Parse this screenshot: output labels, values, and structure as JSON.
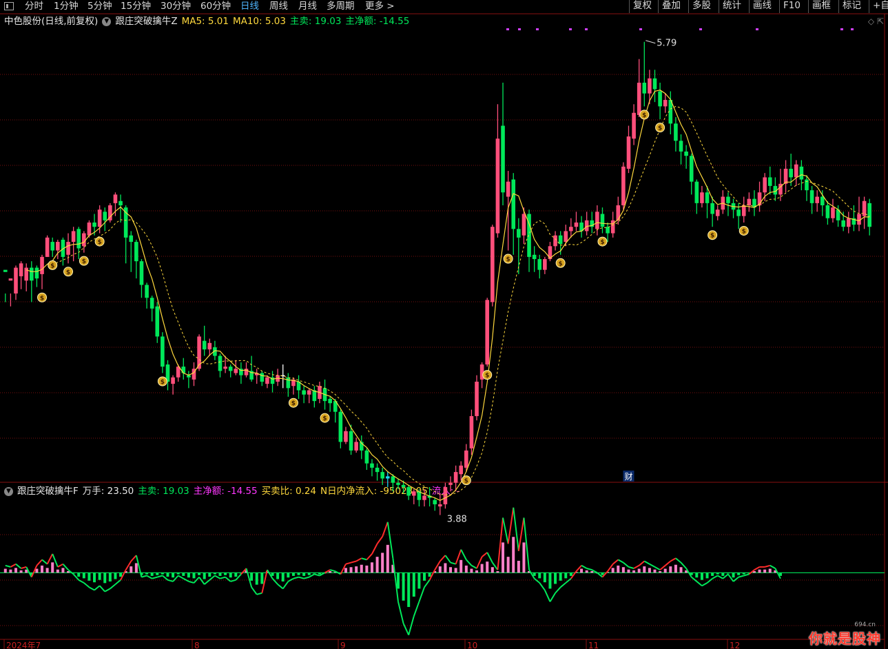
{
  "toolbar": {
    "periods": [
      "分时",
      "1分钟",
      "5分钟",
      "15分钟",
      "30分钟",
      "60分钟",
      "日线",
      "周线",
      "月线",
      "多周期",
      "更多 >"
    ],
    "active_period": "日线",
    "right_buttons": [
      "复权",
      "叠加",
      "多股",
      "统计",
      "画线",
      "F10",
      "画框",
      "标记",
      "+自"
    ]
  },
  "main_header": {
    "stock_title": "中色股份(日线,前复权)",
    "indicator_name": "跟庄突破擒牛Z",
    "ma5": "MA5: 5.01",
    "ma10": "MA10: 5.03",
    "main_sell": "主卖: 19.03",
    "main_net": "主净额: -14.55"
  },
  "sub_header": {
    "indicator_name": "跟庄突破擒牛F",
    "wanshou": "万手: 23.50",
    "main_sell": "主卖: 19.03",
    "main_net": "主净额: -14.55",
    "buy_sell_ratio": "买卖比: 0.24",
    "n_day_inflow": "N日内净流入: -95023.05",
    "inflow": "流入: -"
  },
  "annotations": {
    "high_label": "5.79",
    "low_label": "3.88",
    "finance_marker": "财"
  },
  "watermark": {
    "text": "你就是股神",
    "site": "694.cn"
  },
  "colors": {
    "up": "#ff4f7b",
    "down": "#00e85a",
    "flat": "#ffffff",
    "doji_cyan": "#18d6f0",
    "ma5": "#ffd93d",
    "ma10": "#ffd93d",
    "grid": "#7a1010",
    "flow_pos": "#ff2b2b",
    "flow_neg": "#00e85a",
    "bar_pos": "#ff80c8"
  },
  "chart_data": {
    "type": "candlestick",
    "x_labels": [
      "2024年7",
      "8",
      "9",
      "10",
      "11",
      "12"
    ],
    "y_range": [
      3.8,
      5.85
    ],
    "candles": [
      [
        4.73,
        4.72,
        4.62,
        4.58
      ],
      [
        4.68,
        4.69,
        4.62,
        4.56
      ],
      [
        4.62,
        4.74,
        4.75,
        4.59
      ],
      [
        4.7,
        4.76,
        4.77,
        4.64
      ],
      [
        4.68,
        4.74,
        4.76,
        4.63
      ],
      [
        4.74,
        4.68,
        4.77,
        4.58
      ],
      [
        4.74,
        4.69,
        4.75,
        4.65
      ],
      [
        4.71,
        4.79,
        4.8,
        4.64
      ],
      [
        4.79,
        4.88,
        4.89,
        4.79
      ],
      [
        4.86,
        4.82,
        4.88,
        4.79
      ],
      [
        4.82,
        4.86,
        4.87,
        4.78
      ],
      [
        4.87,
        4.79,
        4.88,
        4.75
      ],
      [
        4.8,
        4.86,
        4.9,
        4.76
      ],
      [
        4.86,
        4.91,
        4.93,
        4.77
      ],
      [
        4.92,
        4.83,
        4.93,
        4.78
      ],
      [
        4.84,
        4.9,
        4.91,
        4.81
      ],
      [
        4.89,
        4.95,
        4.96,
        4.88
      ],
      [
        4.95,
        4.93,
        4.99,
        4.89
      ],
      [
        4.93,
        5.01,
        5.03,
        4.9
      ],
      [
        5.0,
        4.96,
        5.02,
        4.91
      ],
      [
        4.96,
        5.03,
        5.04,
        4.95
      ],
      [
        5.04,
        5.08,
        5.09,
        4.98
      ],
      [
        5.05,
        5.03,
        5.08,
        4.95
      ],
      [
        5.02,
        4.88,
        5.03,
        4.76
      ],
      [
        4.89,
        4.86,
        4.91,
        4.72
      ],
      [
        4.86,
        4.77,
        4.87,
        4.69
      ],
      [
        4.77,
        4.66,
        4.78,
        4.6
      ],
      [
        4.66,
        4.6,
        4.67,
        4.55
      ],
      [
        4.6,
        4.55,
        4.61,
        4.49
      ],
      [
        4.56,
        4.42,
        4.58,
        4.39
      ],
      [
        4.42,
        4.28,
        4.44,
        4.25
      ],
      [
        4.29,
        4.21,
        4.31,
        4.17
      ],
      [
        4.2,
        4.23,
        4.24,
        4.15
      ],
      [
        4.23,
        4.28,
        4.29,
        4.21
      ],
      [
        4.28,
        4.25,
        4.32,
        4.22
      ],
      [
        4.24,
        4.23,
        4.26,
        4.18
      ],
      [
        4.22,
        4.27,
        4.3,
        4.19
      ],
      [
        4.27,
        4.42,
        4.43,
        4.26
      ],
      [
        4.4,
        4.36,
        4.47,
        4.33
      ],
      [
        4.36,
        4.39,
        4.41,
        4.33
      ],
      [
        4.37,
        4.33,
        4.4,
        4.31
      ],
      [
        4.33,
        4.26,
        4.34,
        4.23
      ],
      [
        4.27,
        4.28,
        4.33,
        4.25
      ],
      [
        4.28,
        4.26,
        4.29,
        4.23
      ],
      [
        4.25,
        4.27,
        4.31,
        4.24
      ],
      [
        4.27,
        4.24,
        4.3,
        4.2
      ],
      [
        4.24,
        4.27,
        4.3,
        4.23
      ],
      [
        4.26,
        4.22,
        4.33,
        4.21
      ],
      [
        4.24,
        4.25,
        4.27,
        4.2
      ],
      [
        4.25,
        4.21,
        4.26,
        4.19
      ],
      [
        4.2,
        4.23,
        4.24,
        4.18
      ],
      [
        4.23,
        4.2,
        4.26,
        4.16
      ],
      [
        4.21,
        4.24,
        4.27,
        4.19
      ],
      [
        4.24,
        4.24,
        4.29,
        4.18
      ],
      [
        4.23,
        4.18,
        4.25,
        4.14
      ],
      [
        4.19,
        4.22,
        4.23,
        4.15
      ],
      [
        4.21,
        4.17,
        4.24,
        4.13
      ],
      [
        4.17,
        4.15,
        4.19,
        4.11
      ],
      [
        4.15,
        4.17,
        4.18,
        4.11
      ],
      [
        4.17,
        4.12,
        4.19,
        4.09
      ],
      [
        4.13,
        4.19,
        4.21,
        4.11
      ],
      [
        4.18,
        4.12,
        4.22,
        4.08
      ],
      [
        4.13,
        4.11,
        4.14,
        4.07
      ],
      [
        4.12,
        4.07,
        4.13,
        4.02
      ],
      [
        4.07,
        3.93,
        4.08,
        3.9
      ],
      [
        3.93,
        3.98,
        4.0,
        3.92
      ],
      [
        3.98,
        3.89,
        4.01,
        3.87
      ],
      [
        3.89,
        3.93,
        3.95,
        3.88
      ],
      [
        3.93,
        3.89,
        3.96,
        3.85
      ],
      [
        3.89,
        3.83,
        3.9,
        3.8
      ],
      [
        3.83,
        3.81,
        3.85,
        3.77
      ],
      [
        3.81,
        3.79,
        3.83,
        3.75
      ],
      [
        3.79,
        3.76,
        3.81,
        3.73
      ],
      [
        3.76,
        3.77,
        3.79,
        3.72
      ],
      [
        3.77,
        3.74,
        3.78,
        3.7
      ],
      [
        3.74,
        3.73,
        3.76,
        3.71
      ],
      [
        3.73,
        3.72,
        3.75,
        3.69
      ],
      [
        3.72,
        3.68,
        3.73,
        3.66
      ],
      [
        3.68,
        3.7,
        3.71,
        3.64
      ],
      [
        3.7,
        3.66,
        3.71,
        3.63
      ],
      [
        3.66,
        3.68,
        3.71,
        3.63
      ],
      [
        3.68,
        3.67,
        3.72,
        3.63
      ],
      [
        3.66,
        3.64,
        3.67,
        3.61
      ],
      [
        3.63,
        3.64,
        3.69,
        3.59
      ],
      [
        3.64,
        3.72,
        3.74,
        3.62
      ],
      [
        3.73,
        3.74,
        3.77,
        3.7
      ],
      [
        3.74,
        3.79,
        3.82,
        3.7
      ],
      [
        3.78,
        3.82,
        3.84,
        3.75
      ],
      [
        3.81,
        3.89,
        3.92,
        3.79
      ],
      [
        3.9,
        4.05,
        4.08,
        3.87
      ],
      [
        4.05,
        4.21,
        4.24,
        4.03
      ],
      [
        4.22,
        4.29,
        4.3,
        4.18
      ],
      [
        4.29,
        4.59,
        4.6,
        4.28
      ],
      [
        4.58,
        4.93,
        4.94,
        4.56
      ],
      [
        4.9,
        5.34,
        5.5,
        4.88
      ],
      [
        5.4,
        5.09,
        5.6,
        5.03
      ],
      [
        5.07,
        5.14,
        5.19,
        4.82
      ],
      [
        5.15,
        4.92,
        5.18,
        4.8
      ],
      [
        4.92,
        4.88,
        4.97,
        4.71
      ],
      [
        4.89,
        4.99,
        5.02,
        4.85
      ],
      [
        4.99,
        4.79,
        5.01,
        4.72
      ],
      [
        4.8,
        4.78,
        4.84,
        4.72
      ],
      [
        4.78,
        4.73,
        4.8,
        4.69
      ],
      [
        4.73,
        4.78,
        4.79,
        4.71
      ],
      [
        4.78,
        4.84,
        4.86,
        4.77
      ],
      [
        4.84,
        4.89,
        4.91,
        4.82
      ],
      [
        4.89,
        4.85,
        4.91,
        4.8
      ],
      [
        4.86,
        4.91,
        4.94,
        4.84
      ],
      [
        4.91,
        4.93,
        4.97,
        4.88
      ],
      [
        4.93,
        4.95,
        5.0,
        4.91
      ],
      [
        4.95,
        4.91,
        4.98,
        4.88
      ],
      [
        4.91,
        4.96,
        5.0,
        4.89
      ],
      [
        4.96,
        4.93,
        5.0,
        4.9
      ],
      [
        4.92,
        5.0,
        5.03,
        4.89
      ],
      [
        4.99,
        4.93,
        5.02,
        4.9
      ],
      [
        4.93,
        4.9,
        4.95,
        4.86
      ],
      [
        4.9,
        4.96,
        5.0,
        4.88
      ],
      [
        4.96,
        5.03,
        5.07,
        4.94
      ],
      [
        5.03,
        5.21,
        5.23,
        5.01
      ],
      [
        5.2,
        5.35,
        5.4,
        5.18
      ],
      [
        5.34,
        5.46,
        5.5,
        5.31
      ],
      [
        5.45,
        5.6,
        5.71,
        5.44
      ],
      [
        5.6,
        5.55,
        5.79,
        5.49
      ],
      [
        5.55,
        5.62,
        5.66,
        5.5
      ],
      [
        5.62,
        5.57,
        5.66,
        5.51
      ],
      [
        5.56,
        5.49,
        5.6,
        5.43
      ],
      [
        5.49,
        5.52,
        5.55,
        5.46
      ],
      [
        5.52,
        5.41,
        5.56,
        5.36
      ],
      [
        5.41,
        5.33,
        5.44,
        5.28
      ],
      [
        5.33,
        5.28,
        5.36,
        5.22
      ],
      [
        5.28,
        5.26,
        5.31,
        5.2
      ],
      [
        5.26,
        5.14,
        5.27,
        5.08
      ],
      [
        5.14,
        5.04,
        5.15,
        4.99
      ],
      [
        5.04,
        5.09,
        5.12,
        5.02
      ],
      [
        5.09,
        5.04,
        5.12,
        4.97
      ],
      [
        5.04,
        4.99,
        5.07,
        4.93
      ],
      [
        4.98,
        5.01,
        5.03,
        4.96
      ],
      [
        5.01,
        5.07,
        5.1,
        4.99
      ],
      [
        5.07,
        5.04,
        5.09,
        4.98
      ],
      [
        5.04,
        5.01,
        5.06,
        4.97
      ],
      [
        5.01,
        4.98,
        5.04,
        4.92
      ],
      [
        4.98,
        5.03,
        5.07,
        4.95
      ],
      [
        5.03,
        5.06,
        5.09,
        5.0
      ],
      [
        5.06,
        5.02,
        5.1,
        4.98
      ],
      [
        5.03,
        5.09,
        5.14,
        5.0
      ],
      [
        5.09,
        5.16,
        5.18,
        5.05
      ],
      [
        5.16,
        5.12,
        5.21,
        5.08
      ],
      [
        5.12,
        5.08,
        5.16,
        5.05
      ],
      [
        5.08,
        5.13,
        5.2,
        5.05
      ],
      [
        5.13,
        5.2,
        5.24,
        5.09
      ],
      [
        5.2,
        5.16,
        5.27,
        5.12
      ],
      [
        5.16,
        5.22,
        5.24,
        5.12
      ],
      [
        5.21,
        5.15,
        5.24,
        5.1
      ],
      [
        5.15,
        5.1,
        5.17,
        5.05
      ],
      [
        5.1,
        5.04,
        5.12,
        4.99
      ],
      [
        5.04,
        5.07,
        5.1,
        5.0
      ],
      [
        5.07,
        5.03,
        5.1,
        4.98
      ],
      [
        5.03,
        4.97,
        5.05,
        4.94
      ],
      [
        4.97,
        5.02,
        5.06,
        4.95
      ],
      [
        5.01,
        4.96,
        5.03,
        4.93
      ],
      [
        4.96,
        4.93,
        5.0,
        4.91
      ],
      [
        4.93,
        4.97,
        5.0,
        4.9
      ],
      [
        4.97,
        4.94,
        5.03,
        4.91
      ],
      [
        4.94,
        4.99,
        5.07,
        4.91
      ],
      [
        4.98,
        5.05,
        5.07,
        4.92
      ],
      [
        5.04,
        4.93,
        5.06,
        4.89
      ]
    ],
    "ma5_name": "MA5",
    "ma10_name": "MA10",
    "flow_series_name": "主净额",
    "flow": [
      0.5,
      0.4,
      0.6,
      0.3,
      0.4,
      -0.3,
      0.5,
      0.9,
      0.6,
      1.3,
      0.4,
      0.6,
      0.2,
      -0.1,
      -0.5,
      -0.7,
      -1.0,
      -1.2,
      -0.9,
      -1.3,
      -1.1,
      -0.8,
      -0.5,
      0.2,
      0.8,
      1.2,
      -0.3,
      -0.2,
      -0.4,
      -0.3,
      -0.2,
      -0.5,
      -0.6,
      -0.2,
      -0.4,
      -0.6,
      -0.7,
      -0.3,
      -0.8,
      -0.5,
      -0.2,
      -0.4,
      -0.3,
      -0.6,
      -0.5,
      -0.1,
      0.3,
      -1.0,
      -1.5,
      -1.4,
      0.2,
      -0.4,
      -0.8,
      -1.1,
      -0.6,
      -0.4,
      -0.3,
      -0.4,
      -0.3,
      -0.1,
      -0.2,
      0.0,
      0.2,
      0.1,
      -0.1,
      0.6,
      0.7,
      0.8,
      1.0,
      0.9,
      1.3,
      2.0,
      2.5,
      3.5,
      1.0,
      -2.0,
      -3.5,
      -4.3,
      -3.0,
      -2.0,
      -1.0,
      -0.5,
      0.2,
      0.8,
      1.2,
      0.7,
      0.6,
      1.6,
      0.9,
      0.5,
      0.3,
      1.1,
      1.4,
      0.7,
      0.2,
      3.8,
      2.0,
      4.5,
      1.5,
      3.8,
      0.2,
      -0.4,
      -0.7,
      -1.2,
      -2.0,
      -1.4,
      -1.0,
      -0.7,
      -0.4,
      0.1,
      0.5,
      0.3,
      0.2,
      0.0,
      -0.3,
      0.1,
      0.6,
      0.9,
      0.7,
      0.4,
      0.3,
      0.5,
      0.8,
      0.6,
      0.4,
      0.2,
      0.5,
      0.8,
      1.0,
      0.7,
      0.3,
      -0.3,
      -0.6,
      -0.9,
      -0.7,
      -0.4,
      -0.2,
      -0.4,
      -0.1,
      -0.6,
      -0.3,
      -0.2,
      -0.1,
      0.2,
      0.4,
      0.4,
      0.5,
      0.3,
      -0.4
    ],
    "sub_y_range": [
      -4.6,
      5.2
    ]
  }
}
